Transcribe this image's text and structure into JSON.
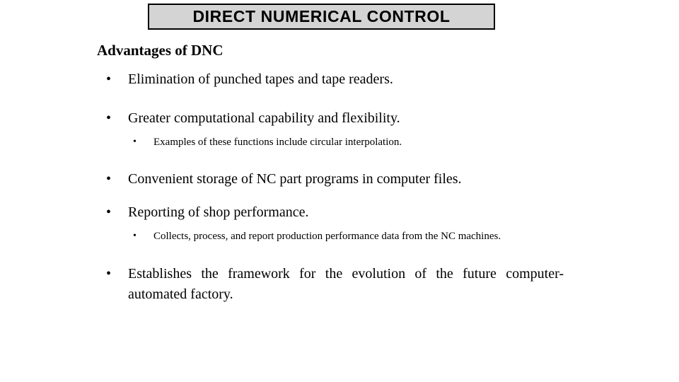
{
  "slide": {
    "title": "DIRECT NUMERICAL CONTROL",
    "heading": "Advantages of DNC",
    "colors": {
      "background": "#ffffff",
      "title_fill": "#d4d4d4",
      "title_border": "#000000",
      "text": "#000000"
    },
    "bullet_glyph": "•",
    "bullets": [
      {
        "level": 1,
        "marker": "•",
        "text": "Elimination of punched tapes and tape readers."
      },
      {
        "level": 1,
        "marker": "•",
        "text": "Greater computational capability and flexibility."
      },
      {
        "level": 2,
        "marker": "•",
        "text": "Examples of these functions include circular interpolation."
      },
      {
        "level": 1,
        "marker": "•",
        "text": "Convenient storage of NC part programs in computer files."
      },
      {
        "level": 1,
        "marker": "•",
        "text": "Reporting of shop performance."
      },
      {
        "level": 2,
        "marker": "•",
        "text": "Collects, process, and report  production performance data from the NC machines."
      },
      {
        "level": 1,
        "marker": "•",
        "text": "Establishes the framework for the evolution of the future computer-automated factory."
      }
    ]
  }
}
